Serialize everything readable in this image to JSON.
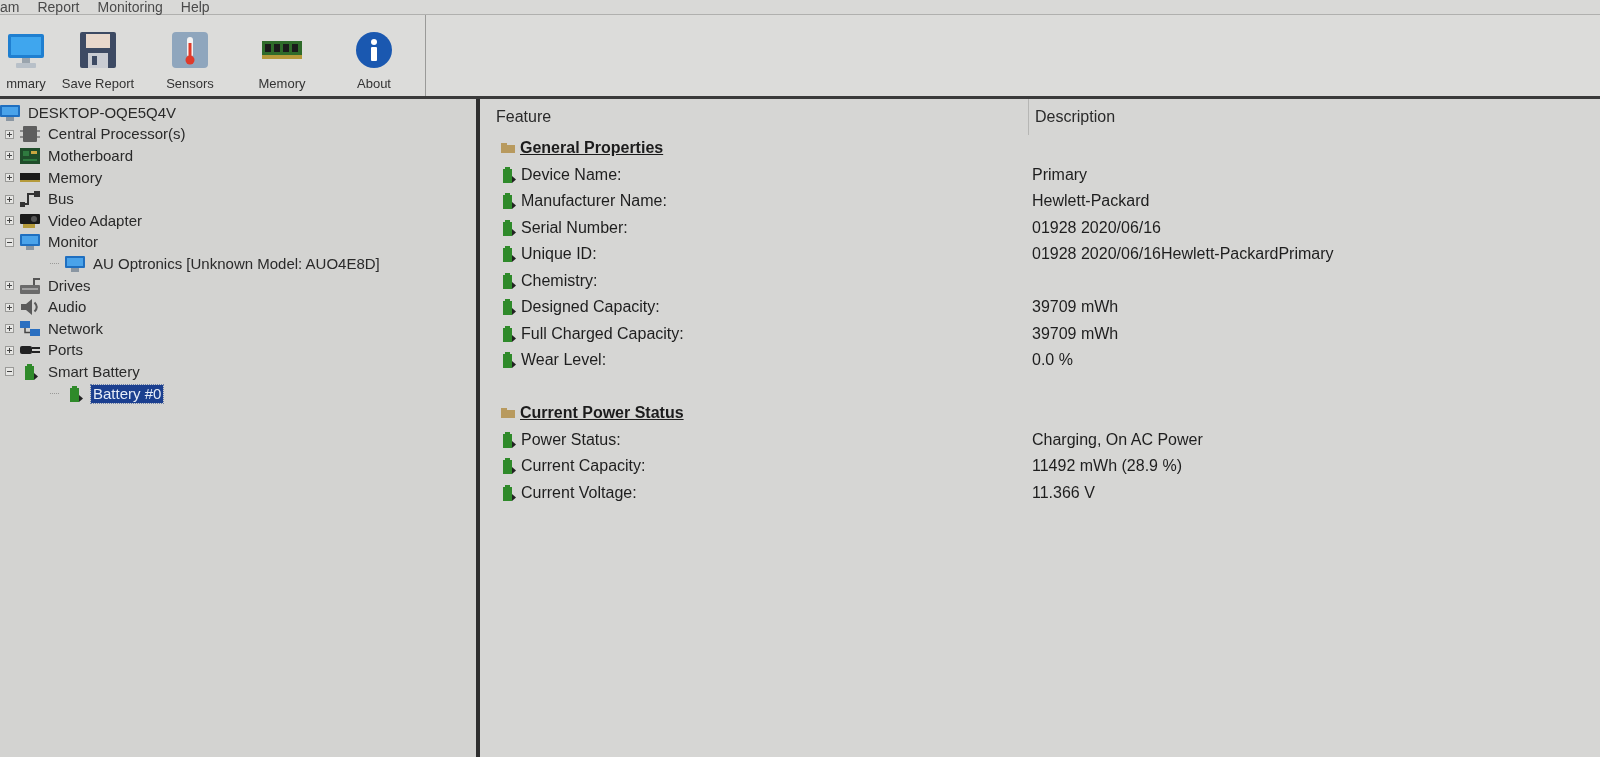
{
  "menu": [
    {
      "label": "am"
    },
    {
      "label": "Report"
    },
    {
      "label": "Monitoring"
    },
    {
      "label": "Help"
    }
  ],
  "toolbar": [
    {
      "label": "mmary",
      "kind": "monitor"
    },
    {
      "label": "Save Report",
      "kind": "disk"
    },
    {
      "label": "Sensors",
      "kind": "thermometer"
    },
    {
      "label": "Memory",
      "kind": "memory"
    },
    {
      "label": "About",
      "kind": "info"
    }
  ],
  "tree": {
    "label": "DESKTOP-OQE5Q4V",
    "kind": "computer",
    "selected": false,
    "children": [
      {
        "label": "Central Processor(s)",
        "kind": "cpu",
        "expanded": false,
        "selected": false
      },
      {
        "label": "Motherboard",
        "kind": "motherboard",
        "expanded": false,
        "selected": false
      },
      {
        "label": "Memory",
        "kind": "memory",
        "expanded": false,
        "selected": false
      },
      {
        "label": "Bus",
        "kind": "bus",
        "expanded": false,
        "selected": false
      },
      {
        "label": "Video Adapter",
        "kind": "video",
        "expanded": false,
        "selected": false
      },
      {
        "label": "Monitor",
        "kind": "monitor",
        "expanded": true,
        "selected": false,
        "children": [
          {
            "label": "AU Optronics [Unknown Model: AUO4E8D]",
            "kind": "monitor",
            "selected": false
          }
        ]
      },
      {
        "label": "Drives",
        "kind": "drive",
        "expanded": false,
        "selected": false
      },
      {
        "label": "Audio",
        "kind": "audio",
        "expanded": false,
        "selected": false
      },
      {
        "label": "Network",
        "kind": "network",
        "expanded": false,
        "selected": false
      },
      {
        "label": "Ports",
        "kind": "ports",
        "expanded": false,
        "selected": false
      },
      {
        "label": "Smart Battery",
        "kind": "battery",
        "expanded": true,
        "selected": false,
        "children": [
          {
            "label": "Battery #0",
            "kind": "battery",
            "selected": true
          }
        ]
      }
    ]
  },
  "details": {
    "columns": [
      "Feature",
      "Description"
    ],
    "sections": [
      {
        "title": "General Properties",
        "rows": [
          {
            "feature": "Device Name:",
            "value": "Primary"
          },
          {
            "feature": "Manufacturer Name:",
            "value": "Hewlett-Packard"
          },
          {
            "feature": "Serial Number:",
            "value": "01928 2020/06/16"
          },
          {
            "feature": "Unique ID:",
            "value": "01928 2020/06/16Hewlett-PackardPrimary"
          },
          {
            "feature": "Chemistry:"
          },
          {
            "feature": "Designed Capacity:",
            "value": "39709 mWh"
          },
          {
            "feature": "Full Charged Capacity:",
            "value": "39709 mWh"
          },
          {
            "feature": "Wear Level:",
            "value": "0.0 %"
          }
        ]
      },
      {
        "title": "Current Power Status",
        "rows": [
          {
            "feature": "Power Status:",
            "value": "Charging, On AC Power"
          },
          {
            "feature": "Current Capacity:",
            "value": "11492 mWh (28.9 %)"
          },
          {
            "feature": "Current Voltage:",
            "value": "11.366 V"
          }
        ]
      }
    ]
  }
}
